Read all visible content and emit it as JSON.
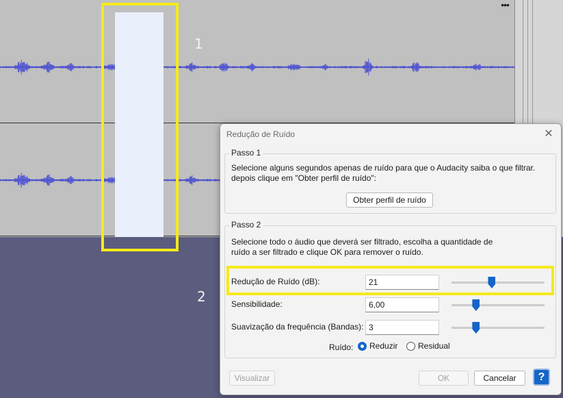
{
  "annotations": {
    "step1_number": "1",
    "step2_number": "2"
  },
  "track": {
    "menu_icon": "ellipsis-icon",
    "waveform_color": "#4a4fd0",
    "selection_color": "#e9f0fc",
    "highlight_color": "#f5ea1c"
  },
  "dialog": {
    "title": "Redução de Ruído",
    "close_icon": "close-icon",
    "step1": {
      "legend": "Passo 1",
      "line1": "Selecione alguns segundos apenas de ruído para que o Audacity saiba o que filtrar.",
      "line2": "depois clique em \"Obter perfil de ruído\":",
      "get_profile_button": "Obter perfil de ruído"
    },
    "step2": {
      "legend": "Passo 2",
      "line1": "Selecione todo o áudio que deverá ser filtrado, escolha a quantidade de",
      "line2": "ruído a ser filtrado e clique OK para remover o ruído.",
      "params": {
        "noise_reduction": {
          "label": "Redução de Ruído (dB):",
          "value": "21",
          "slider_level": 0.43
        },
        "sensitivity": {
          "label": "Sensibilidade:",
          "value": "6,00",
          "slider_level": 0.26
        },
        "freq_smoothing": {
          "label": "Suavização da frequência (Bandas):",
          "value": "3",
          "slider_level": 0.26
        }
      },
      "noise_mode": {
        "label": "Ruído:",
        "reduce": "Reduzir",
        "residual": "Residual",
        "selected": "Reduzir"
      }
    },
    "buttons": {
      "preview": "Visualizar",
      "ok": "OK",
      "cancel": "Cancelar",
      "help_icon": "help-icon",
      "help": "?"
    }
  }
}
